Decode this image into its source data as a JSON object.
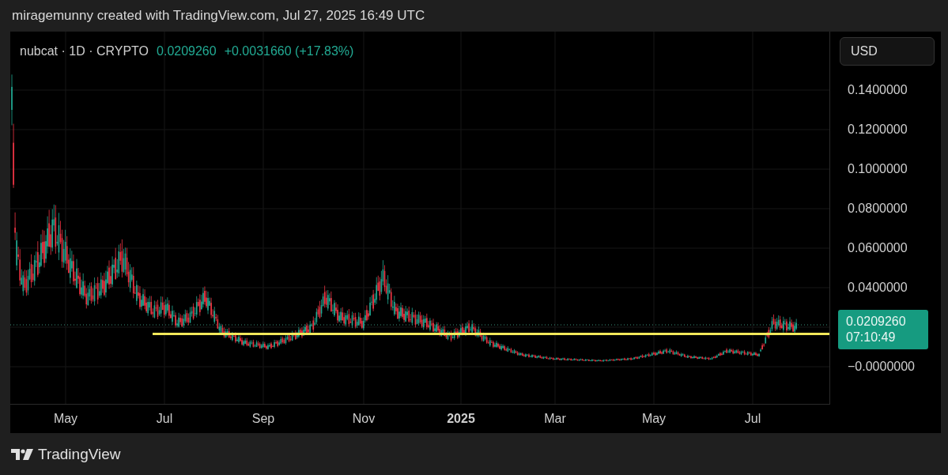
{
  "header": {
    "caption": "miragemunny created with TradingView.com, Jul 27, 2025 16:49 UTC"
  },
  "legend": {
    "symbol": "nubcat · 1D · CRYPTO",
    "price": "0.0209260",
    "change": "+0.0031660 (+17.83%)"
  },
  "currency_button": {
    "label": "USD"
  },
  "price_axis": {
    "labels": [
      "0.1400000",
      "0.1200000",
      "0.1000000",
      "0.0800000",
      "0.0600000",
      "0.0400000",
      "−0.0000000"
    ]
  },
  "last_price_tag": {
    "price": "0.0209260",
    "countdown": "07:10:49"
  },
  "time_axis": {
    "labels": [
      {
        "text": "May",
        "kind": "month"
      },
      {
        "text": "Jul",
        "kind": "month"
      },
      {
        "text": "Sep",
        "kind": "month"
      },
      {
        "text": "Nov",
        "kind": "month"
      },
      {
        "text": "2025",
        "kind": "year"
      },
      {
        "text": "Mar",
        "kind": "month"
      },
      {
        "text": "May",
        "kind": "month"
      },
      {
        "text": "Jul",
        "kind": "month"
      }
    ]
  },
  "footer": {
    "brand": "TradingView"
  }
}
